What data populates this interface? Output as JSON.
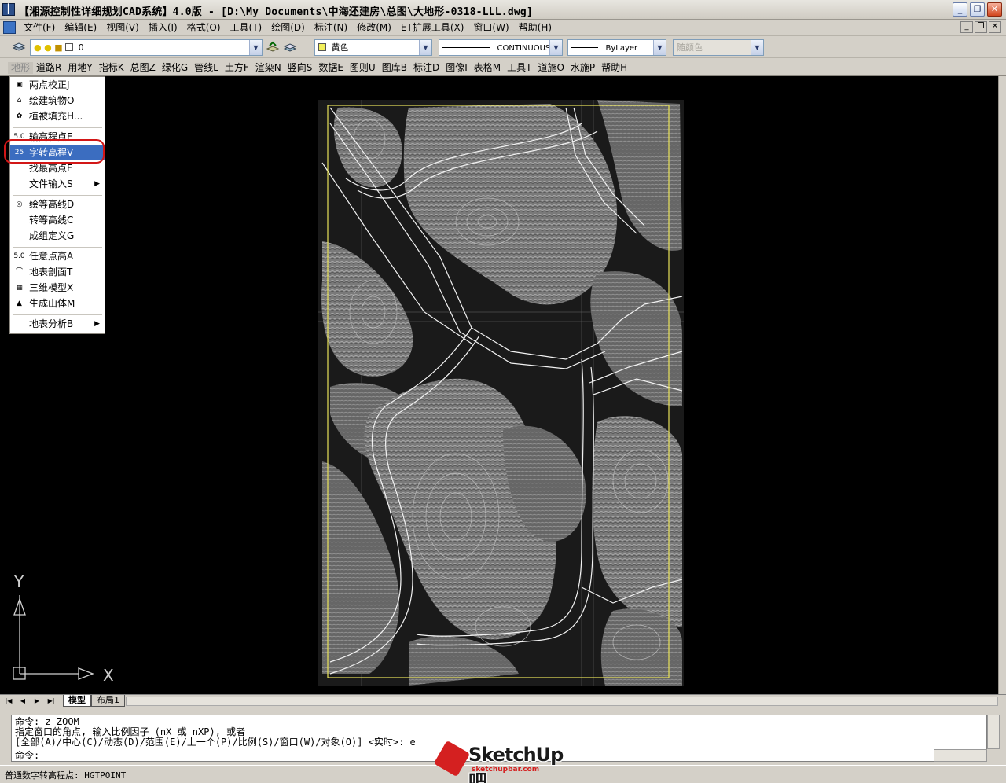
{
  "window": {
    "title": "【湘源控制性详细规划CAD系统】4.0版 - [D:\\My Documents\\中海还建房\\总图\\大地形-0318-LLL.dwg]",
    "minimize": "_",
    "restore": "❐",
    "close": "✕"
  },
  "menubar": {
    "items": [
      "文件(F)",
      "编辑(E)",
      "视图(V)",
      "插入(I)",
      "格式(O)",
      "工具(T)",
      "绘图(D)",
      "标注(N)",
      "修改(M)",
      "ET扩展工具(X)",
      "窗口(W)",
      "帮助(H)"
    ],
    "mdi_min": "_",
    "mdi_restore": "❐",
    "mdi_close": "✕"
  },
  "toolbar": {
    "layer_value": "0",
    "color_value": "黄色",
    "color_swatch": "#f2ef5a",
    "linetype_value": "CONTINUOUS",
    "lineweight_value": "ByLayer",
    "plotstyle_value": "随颜色"
  },
  "plugin_menu": {
    "items": [
      "地形",
      "道路R",
      "用地Y",
      "指标K",
      "总图Z",
      "绿化G",
      "管线L",
      "土方F",
      "渲染N",
      "竖向S",
      "数据E",
      "图则U",
      "图库B",
      "标注D",
      "图像I",
      "表格M",
      "工具T",
      "道施O",
      "水施P",
      "帮助H"
    ],
    "active_index": 0
  },
  "dropdown": {
    "items": [
      {
        "label": "两点校正J",
        "icon": "calibrate-icon",
        "glyph": "▣"
      },
      {
        "label": "绘建筑物O",
        "icon": "building-icon",
        "glyph": "⌂"
      },
      {
        "label": "植被填充H...",
        "icon": "vegetation-icon",
        "glyph": "✿"
      },
      {
        "label": "输高程点E",
        "icon": "elevation-input-icon",
        "glyph": "5.0"
      },
      {
        "label": "字转高程V",
        "icon": "text-to-elevation-icon",
        "glyph": "25"
      },
      {
        "label": "找最高点F",
        "icon": "",
        "glyph": ""
      },
      {
        "label": "文件输入S",
        "icon": "",
        "glyph": "",
        "submenu": true
      },
      {
        "label": "绘等高线D",
        "icon": "contour-icon",
        "glyph": "◎"
      },
      {
        "label": "转等高线C",
        "icon": "",
        "glyph": ""
      },
      {
        "label": "成组定义G",
        "icon": "",
        "glyph": ""
      },
      {
        "label": "任意点高A",
        "icon": "point-height-icon",
        "glyph": "5.0"
      },
      {
        "label": "地表剖面T",
        "icon": "profile-icon",
        "glyph": "⌒"
      },
      {
        "label": "三维模型X",
        "icon": "3d-model-icon",
        "glyph": "▦"
      },
      {
        "label": "生成山体M",
        "icon": "mountain-icon",
        "glyph": "▲"
      },
      {
        "label": "地表分析B",
        "icon": "",
        "glyph": "",
        "submenu": true
      }
    ],
    "selected_index": 4
  },
  "ucs": {
    "x_label": "X",
    "y_label": "Y"
  },
  "layout_tabs": {
    "nav": [
      "|◀",
      "◀",
      "▶",
      "▶|"
    ],
    "tabs": [
      "模型",
      "布局1"
    ],
    "active": 0
  },
  "command": {
    "lines": [
      "命令: z ZOOM",
      "指定窗口的角点, 输入比例因子 (nX 或 nXP), 或者",
      "[全部(A)/中心(C)/动态(D)/范围(E)/上一个(P)/比例(S)/窗口(W)/对象(O)] <实时>: e",
      "命令:"
    ]
  },
  "status": {
    "text": "普通数字转高程点: HGTPOINT"
  },
  "watermark": {
    "brand": "SketchUp吧",
    "url": "sketchupbar.com"
  },
  "colors": {
    "frame_yellow": "#e8e25a",
    "road_white": "#f2f2f2",
    "contour_gray": "#8e8e8e",
    "highlight_red": "#d21616",
    "selection_blue": "#3b6dc0"
  }
}
